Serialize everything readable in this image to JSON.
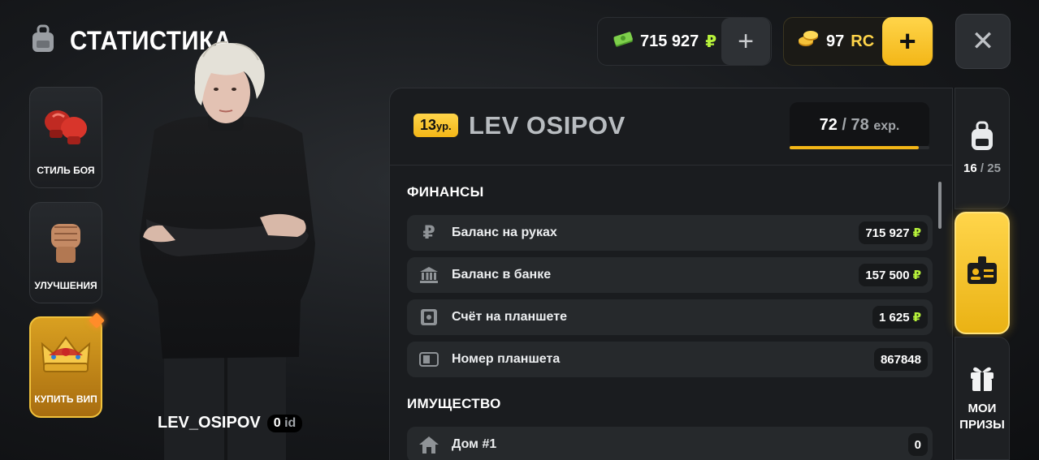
{
  "header": {
    "title": "СТАТИСТИКА",
    "icons": {
      "title": "backpack-icon"
    }
  },
  "currency": {
    "cash": {
      "value": "715 927",
      "symbol": "₽",
      "icon": "cash-stack-icon",
      "plus": "+"
    },
    "rc": {
      "value": "97",
      "unit": "RC",
      "icon": "gold-coins-icon",
      "plus": "+"
    }
  },
  "close": {
    "label": "✕",
    "icon": "close-icon"
  },
  "left_menu": [
    {
      "label": "СТИЛЬ БОЯ",
      "icon": "boxing-gloves-icon"
    },
    {
      "label": "УЛУЧШЕНИЯ",
      "icon": "fist-icon"
    },
    {
      "label": "КУПИТЬ ВИП",
      "icon": "crown-icon"
    }
  ],
  "character": {
    "name": "LEV_OSIPOV",
    "id_value": "0",
    "id_label": "id"
  },
  "profile": {
    "level": "13",
    "level_suffix": "ур.",
    "name": "LEV OSIPOV",
    "exp_current": "72",
    "exp_sep": "/",
    "exp_max": "78",
    "exp_unit": "exp.",
    "exp_fraction": 0.923
  },
  "sections": {
    "finance_title": "ФИНАНСЫ",
    "property_title": "ИМУЩЕСТВО"
  },
  "finance_rows": [
    {
      "label": "Баланс на руках",
      "value": "715 927",
      "currency": "₽",
      "icon": "ruble-icon"
    },
    {
      "label": "Баланс в банке",
      "value": "157 500",
      "currency": "₽",
      "icon": "bank-icon"
    },
    {
      "label": "Счёт на планшете",
      "value": "1 625",
      "currency": "₽",
      "icon": "tablet-account-icon"
    },
    {
      "label": "Номер планшета",
      "value": "867848",
      "currency": "",
      "icon": "tablet-icon"
    }
  ],
  "property_rows": [
    {
      "label": "Дом #1",
      "value": "0",
      "icon": "house-icon"
    }
  ],
  "right_tabs": {
    "inventory": {
      "current": "16",
      "sep": "/",
      "max": "25",
      "icon": "backpack-icon"
    },
    "profile": {
      "icon": "id-card-icon",
      "active": true
    },
    "prizes": {
      "label_line1": "МОИ",
      "label_line2": "ПРИЗЫ",
      "icon": "gift-icon"
    }
  },
  "colors": {
    "accent_gold": "#f3b617",
    "ruble_green": "#b7f23b",
    "rc_gold": "#ffd54a"
  }
}
